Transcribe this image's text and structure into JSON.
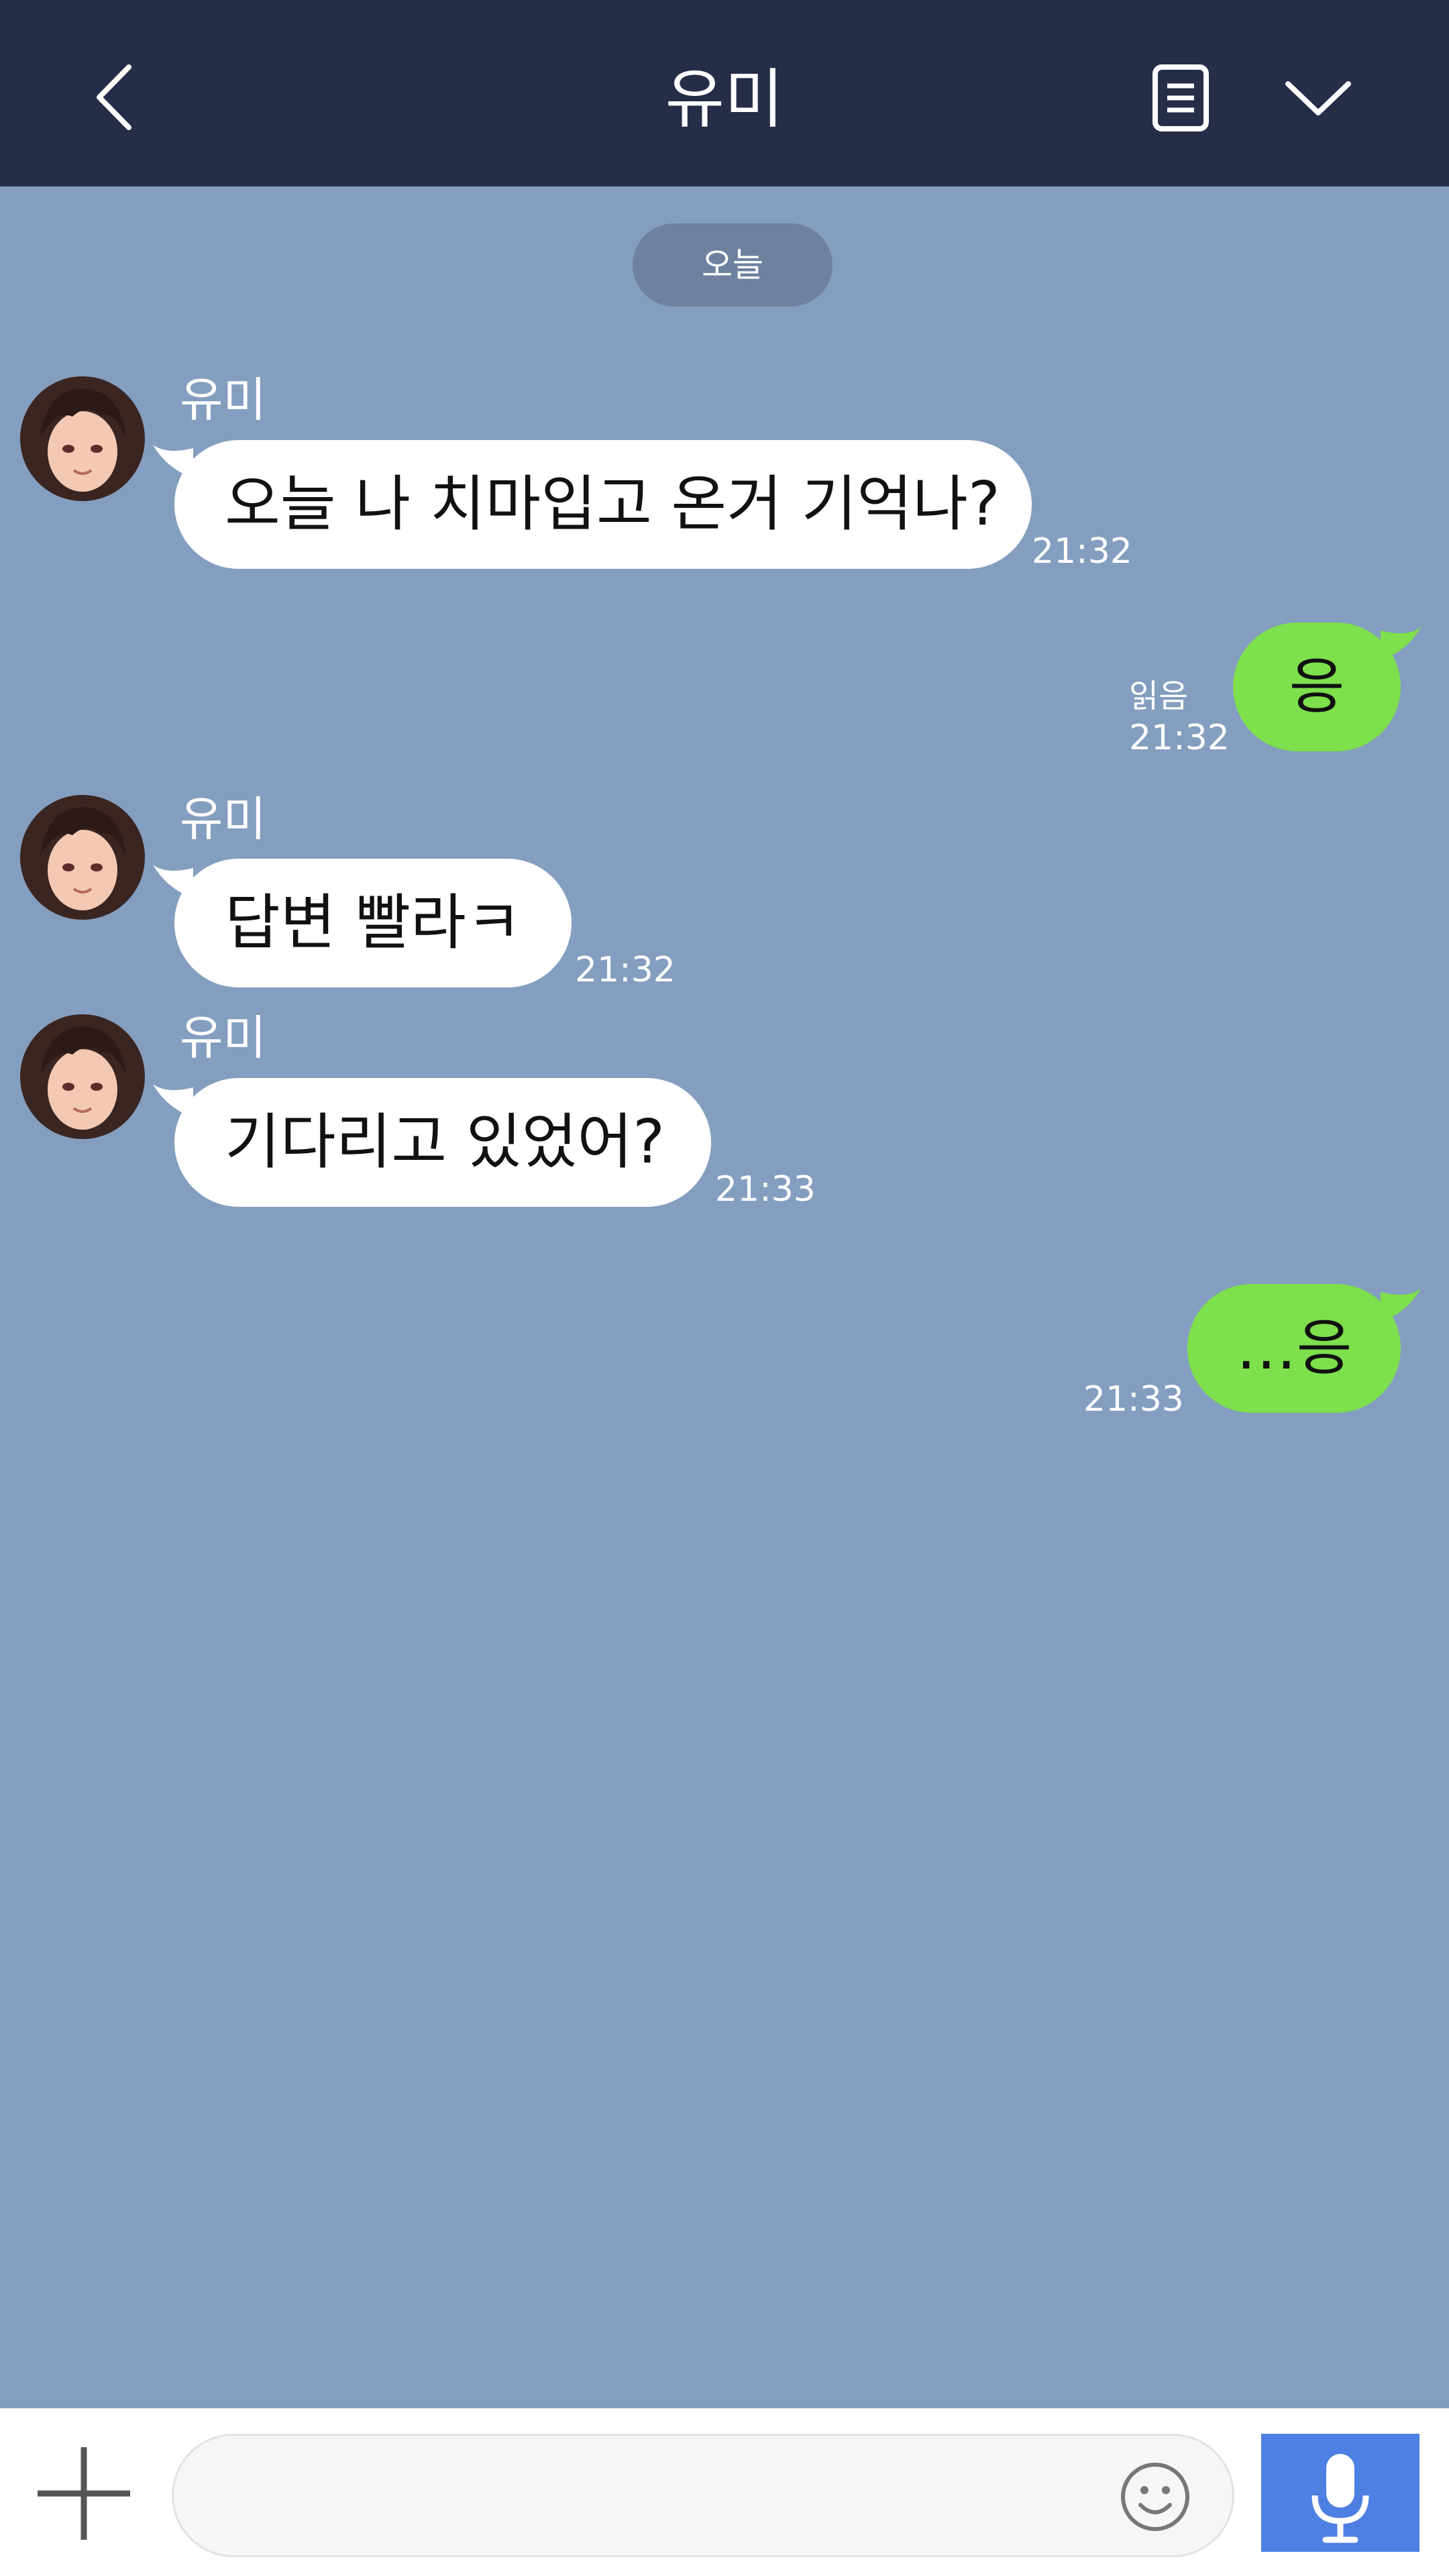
{
  "header": {
    "title": "유미",
    "back_icon": "chevron-left-icon",
    "notes_icon": "notes-icon",
    "menu_icon": "chevron-down-icon",
    "background": "#252D47"
  },
  "chat": {
    "background": "#849EBF",
    "date_label": "오늘",
    "messages": [
      {
        "sender": "유미",
        "text": "오늘 나 치마입고 온거 기억나?",
        "time": "21:32",
        "direction": "in"
      },
      {
        "text": "응",
        "time": "21:32",
        "read": "읽음",
        "direction": "out"
      },
      {
        "sender": "유미",
        "text": "답변 빨라ㅋ",
        "time": "21:32",
        "direction": "in"
      },
      {
        "sender": "유미",
        "text": "기다리고 있었어?",
        "time": "21:33",
        "direction": "in"
      },
      {
        "text": "…응",
        "time": "21:33",
        "direction": "out"
      }
    ]
  },
  "composer": {
    "plus_icon": "plus-icon",
    "emoji_icon": "smiley-icon",
    "mic_icon": "microphone-icon",
    "mic_color": "#4E7FE3",
    "outgoing_color": "#7DE04C"
  }
}
